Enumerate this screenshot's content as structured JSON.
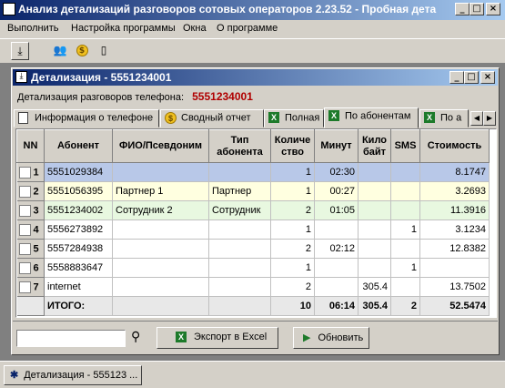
{
  "app": {
    "title": "Анализ детализаций разговоров сотовых операторов 2.23.52 - Пробная дета",
    "title_icon": "app-icon",
    "window_buttons": [
      "_",
      "□",
      "×"
    ]
  },
  "menu": {
    "items": [
      "Выполнить",
      "Настройка программы",
      "Окна",
      "О программе"
    ]
  },
  "toolbar": {
    "buttons": [
      "download-icon",
      "users-icon",
      "coins-icon",
      "phone-icon"
    ]
  },
  "child_window": {
    "title": "Детализация - 5551234001",
    "phone_label": "Детализация разговоров телефона:",
    "phone_number": "5551234001",
    "tabs": [
      {
        "label": "Информация о телефоне",
        "icon": "document-icon"
      },
      {
        "label": "Сводный отчет",
        "icon": "coin-icon"
      },
      {
        "label": "Полная",
        "icon": "excel-icon"
      },
      {
        "label": "По абонентам",
        "icon": "excel-icon",
        "active": true
      },
      {
        "label": "По а",
        "icon": "excel-icon"
      }
    ]
  },
  "table": {
    "headers": [
      "NN",
      "Абонент",
      "ФИО/Псевдоним",
      "Тип абонента",
      "Количе ство",
      "Минут",
      "Кило байт",
      "SMS",
      "Стоимость"
    ],
    "rows": [
      {
        "nn": "1",
        "abonent": "5551029384",
        "fio": "",
        "type": "",
        "count": "1",
        "minutes": "02:30",
        "kb": "",
        "sms": "",
        "cost": "8.1747",
        "style": "sel"
      },
      {
        "nn": "2",
        "abonent": "5551056395",
        "fio": "Партнер 1",
        "type": "Партнер",
        "count": "1",
        "minutes": "00:27",
        "kb": "",
        "sms": "",
        "cost": "3.2693",
        "style": "yel"
      },
      {
        "nn": "3",
        "abonent": "5551234002",
        "fio": "Сотрудник 2",
        "type": "Сотрудник",
        "count": "2",
        "minutes": "01:05",
        "kb": "",
        "sms": "",
        "cost": "11.3916",
        "style": "grn"
      },
      {
        "nn": "4",
        "abonent": "5556273892",
        "fio": "",
        "type": "",
        "count": "1",
        "minutes": "",
        "kb": "",
        "sms": "1",
        "cost": "3.1234",
        "style": ""
      },
      {
        "nn": "5",
        "abonent": "5557284938",
        "fio": "",
        "type": "",
        "count": "2",
        "minutes": "02:12",
        "kb": "",
        "sms": "",
        "cost": "12.8382",
        "style": ""
      },
      {
        "nn": "6",
        "abonent": "5558883647",
        "fio": "",
        "type": "",
        "count": "1",
        "minutes": "",
        "kb": "",
        "sms": "1",
        "cost": "",
        "style": ""
      },
      {
        "nn": "7",
        "abonent": "internet",
        "fio": "",
        "type": "",
        "count": "2",
        "minutes": "",
        "kb": "305.4",
        "sms": "",
        "cost": "13.7502",
        "style": ""
      }
    ],
    "total": {
      "label": "ИТОГО:",
      "count": "10",
      "minutes": "06:14",
      "kb": "305.4",
      "sms": "2",
      "cost": "52.5474"
    }
  },
  "bottom": {
    "search_value": "",
    "export_label": "Экспорт в Excel",
    "refresh_label": "Обновить"
  },
  "taskbar": {
    "item_label": "Детализация - 555123 ..."
  },
  "colors": {
    "title_bar": "#0a246a",
    "selected_row": "#b8c8e8",
    "partner_row": "#ffffe0",
    "employee_row": "#e8f8e0",
    "phone_number": "#b00000"
  }
}
